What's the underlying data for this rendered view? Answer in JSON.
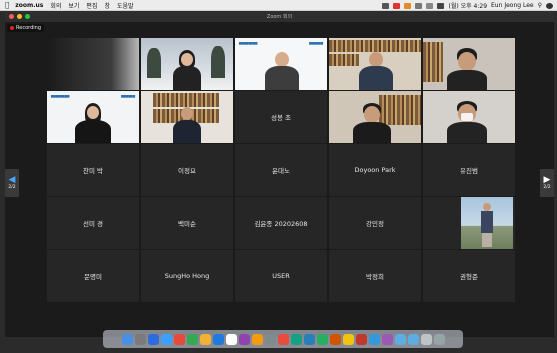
{
  "menubar": {
    "app_name": "zoom.us",
    "menus": [
      "회의",
      "보기",
      "편집",
      "창",
      "도움말"
    ],
    "clock": "(월) 오후 4:29",
    "user": "Eun Jeong Lee"
  },
  "window": {
    "title": "Zoom 회의",
    "recording_label": "Recording"
  },
  "pager": {
    "left_page": "2/2",
    "right_page": "2/2"
  },
  "tiles": [
    {
      "name": "",
      "video": true
    },
    {
      "name": "",
      "video": true
    },
    {
      "name": "",
      "video": true
    },
    {
      "name": "",
      "video": true
    },
    {
      "name": "",
      "video": true
    },
    {
      "name": "",
      "video": true
    },
    {
      "name": "",
      "video": true
    },
    {
      "name": "성봉 조",
      "video": false
    },
    {
      "name": "",
      "video": true
    },
    {
      "name": "",
      "video": true
    },
    {
      "name": "찬미 박",
      "video": false
    },
    {
      "name": "이정요",
      "video": false
    },
    {
      "name": "윤대노",
      "video": false
    },
    {
      "name": "Doyoon Park",
      "video": false
    },
    {
      "name": "유진범",
      "video": false
    },
    {
      "name": "선미 경",
      "video": false
    },
    {
      "name": "백미순",
      "video": false
    },
    {
      "name": "김윤종 20202608",
      "video": false
    },
    {
      "name": "강민정",
      "video": false
    },
    {
      "name": "",
      "video": true
    },
    {
      "name": "문명미",
      "video": false
    },
    {
      "name": "SungHo Hong",
      "video": false
    },
    {
      "name": "USER",
      "video": false
    },
    {
      "name": "박정희",
      "video": false
    },
    {
      "name": "권형준",
      "video": false
    }
  ],
  "colors": {
    "recording_dot": "#e02424",
    "nav_arrow_accent": "#4aa3ff",
    "tile_bg": "#262626"
  },
  "icons": [
    "apple-icon",
    "wifi-icon",
    "search-icon",
    "control-center-icon",
    "left-arrow-icon",
    "right-arrow-icon"
  ]
}
